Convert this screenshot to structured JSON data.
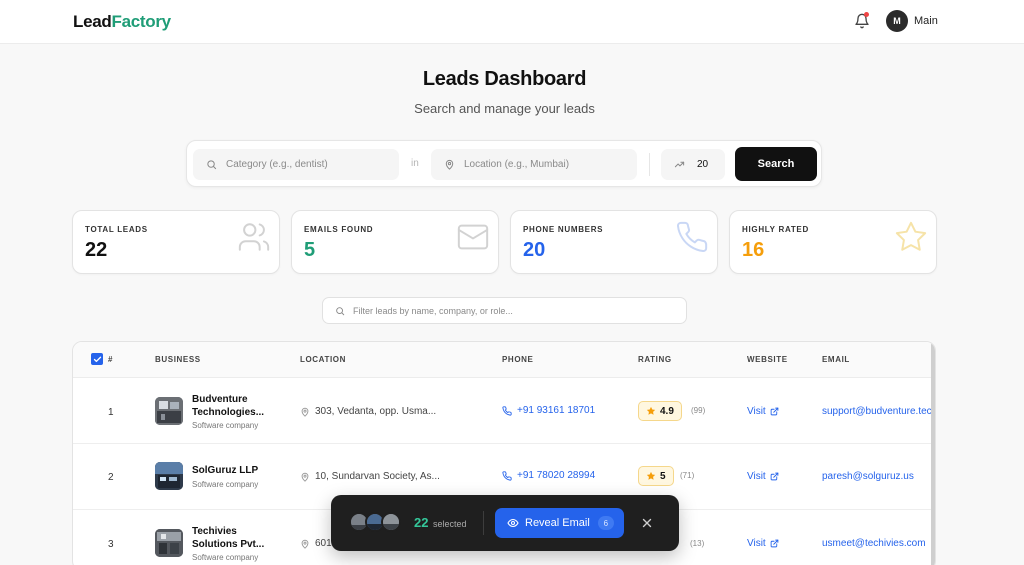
{
  "header": {
    "logo_part1": "Lead",
    "logo_part2": "Factory",
    "avatar_initial": "M",
    "user_name": "Main"
  },
  "hero": {
    "title": "Leads Dashboard",
    "subtitle": "Search and manage your leads"
  },
  "search": {
    "category_placeholder": "Category (e.g., dentist)",
    "connector": "in",
    "location_placeholder": "Location (e.g., Mumbai)",
    "count_value": "20",
    "button_label": "Search"
  },
  "stats": [
    {
      "label": "TOTAL LEADS",
      "value": "22",
      "color": "#111111",
      "icon": "users-icon"
    },
    {
      "label": "EMAILS FOUND",
      "value": "5",
      "color": "#1f9d77",
      "icon": "mail-icon"
    },
    {
      "label": "PHONE NUMBERS",
      "value": "20",
      "color": "#2563eb",
      "icon": "phone-icon"
    },
    {
      "label": "HIGHLY RATED",
      "value": "16",
      "color": "#f59e0b",
      "icon": "star-icon"
    }
  ],
  "filter": {
    "placeholder": "Filter leads by name, company, or role..."
  },
  "table": {
    "columns": [
      "#",
      "BUSINESS",
      "LOCATION",
      "PHONE",
      "RATING",
      "WEBSITE",
      "EMAIL"
    ],
    "rows": [
      {
        "index": "1",
        "name_line1": "Budventure",
        "name_line2": "Technologies...",
        "category": "Software company",
        "location": "303, Vedanta, opp. Usma...",
        "phone": "+91 93161 18701",
        "rating": "4.9",
        "rating_count": "(99)",
        "website": "Visit",
        "email": "support@budventure.tech"
      },
      {
        "index": "2",
        "name_line1": "SolGuruz LLP",
        "name_line2": "",
        "category": "Software company",
        "location": "10, Sundarvan Society, As...",
        "phone": "+91 78020 28994",
        "rating": "5",
        "rating_count": "(71)",
        "website": "Visit",
        "email": "paresh@solguruz.us"
      },
      {
        "index": "3",
        "name_line1": "Techivies",
        "name_line2": "Solutions Pvt...",
        "category": "Software company",
        "location": "601",
        "phone": "",
        "rating": "",
        "rating_count": "(13)",
        "website": "Visit",
        "email": "usmeet@techivies.com"
      }
    ]
  },
  "selection_bar": {
    "count": "22",
    "word": "selected",
    "reveal_label": "Reveal Email",
    "reveal_badge": "6"
  }
}
